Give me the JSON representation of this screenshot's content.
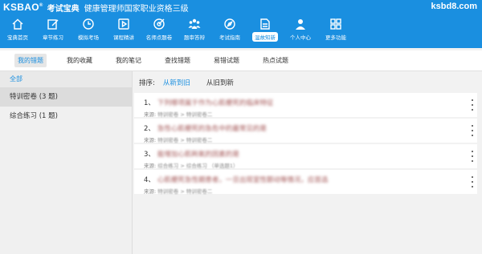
{
  "header": {
    "logo": "KSBAO",
    "logo_mark": "®",
    "brand": "考试宝典",
    "app_title": "健康管理师国家职业资格三级",
    "domain": "ksbd8.com"
  },
  "nav": [
    {
      "label": "宝典首页",
      "icon": "home-icon"
    },
    {
      "label": "章节练习",
      "icon": "edit-icon"
    },
    {
      "label": "模拟考场",
      "icon": "clock-icon"
    },
    {
      "label": "课程精讲",
      "icon": "play-icon"
    },
    {
      "label": "名师点题卷",
      "icon": "target-icon"
    },
    {
      "label": "题审答辩",
      "icon": "group-icon"
    },
    {
      "label": "考试指南",
      "icon": "compass-icon"
    },
    {
      "label": "温故知新",
      "icon": "document-icon",
      "active": true
    },
    {
      "label": "个人中心",
      "icon": "user-icon"
    },
    {
      "label": "更多功能",
      "icon": "grid-icon"
    }
  ],
  "tabs": [
    {
      "label": "我的错题",
      "active": true
    },
    {
      "label": "我的收藏"
    },
    {
      "label": "我的笔记"
    },
    {
      "label": "查找错题"
    },
    {
      "label": "易错试题"
    },
    {
      "label": "热点试题"
    }
  ],
  "sidebar": {
    "all_label": "全部",
    "items": [
      {
        "label": "特训密卷 (3 题)",
        "selected": true
      },
      {
        "label": "综合练习 (1 题)"
      }
    ]
  },
  "sort": {
    "label": "排序:",
    "options": [
      {
        "label": "从新到旧",
        "active": true
      },
      {
        "label": "从旧到新"
      }
    ]
  },
  "questions": [
    {
      "num": "1、",
      "title": "下列哪项属于作为心肌梗死的临床特征",
      "source_prefix": "来源:",
      "source": "特训密卷 > 特训密卷二"
    },
    {
      "num": "2、",
      "title": "急性心肌梗死的急危中的最常见的是",
      "source_prefix": "来源:",
      "source": "特训密卷 > 特训密卷二"
    },
    {
      "num": "3、",
      "title": "能增加心肌耗氧的因素的是",
      "source_prefix": "来源:",
      "source": "综合练习 > 综合练习 （单选题1）"
    },
    {
      "num": "4、",
      "title": "心肌梗死急性期患者，一旦出现室性颤动等情况，应首选",
      "source_prefix": "来源:",
      "source": "特训密卷 > 特训密卷二"
    }
  ],
  "colors": {
    "primary": "#1a8fe0"
  }
}
